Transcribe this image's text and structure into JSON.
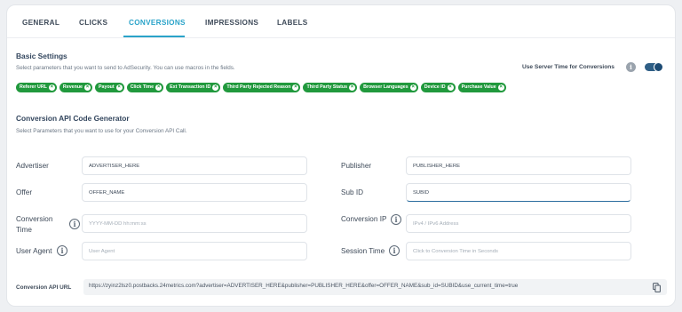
{
  "tabs": [
    {
      "label": "GENERAL"
    },
    {
      "label": "CLICKS"
    },
    {
      "label": "CONVERSIONS",
      "active": true
    },
    {
      "label": "IMPRESSIONS"
    },
    {
      "label": "LABELS"
    }
  ],
  "basic_settings": {
    "title": "Basic Settings",
    "hint": "Select parameters that you want to send to AdSecurity. You can use macros in the fields.",
    "server_time_label": "Use Server Time for Conversions",
    "server_time_enabled": true,
    "chips": [
      "Referer URL",
      "Revenue",
      "Payout",
      "Click Time",
      "Ext Transaction ID",
      "Third Party Rejected Reason",
      "Third Party Status",
      "Browser Languages",
      "Device ID",
      "Purchase Value"
    ]
  },
  "api_generator": {
    "title": "Conversion API Code Generator",
    "hint": "Select Parameters that you want to use for your Conversion API Call.",
    "fields": {
      "advertiser": {
        "label": "Advertiser",
        "value": "ADVERTISER_HERE",
        "placeholder": ""
      },
      "publisher": {
        "label": "Publisher",
        "value": "PUBLISHER_HERE",
        "placeholder": ""
      },
      "offer": {
        "label": "Offer",
        "value": "OFFER_NAME",
        "placeholder": ""
      },
      "sub_id": {
        "label": "Sub ID",
        "value": "SUBID",
        "placeholder": ""
      },
      "conversion_time": {
        "label_line1": "Conversion",
        "label_line2": "Time",
        "value": "",
        "placeholder": "YYYY-MM-DD hh:mm:ss"
      },
      "conversion_ip": {
        "label": "Conversion IP",
        "value": "",
        "placeholder": "IPv4 / IPv6 Address"
      },
      "user_agent": {
        "label": "User Agent",
        "value": "",
        "placeholder": "User Agent"
      },
      "session_time": {
        "label": "Session Time",
        "value": "",
        "placeholder": "Click to Conversion Time in Seconds"
      }
    },
    "url_label": "Conversion API URL",
    "url_value": "https://zyinz2lsz0.postbacks.24metrics.com?advertiser=ADVERTISER_HERE&publisher=PUBLISHER_HERE&offer=OFFER_NAME&sub_id=SUBID&use_current_time=true"
  },
  "icons": {
    "info": "info-icon",
    "chip_remove": "close-circle-icon",
    "copy": "copy-icon"
  },
  "colors": {
    "accent": "#2aa3c9",
    "chip": "#21993d",
    "toggle": "#1d4b74"
  }
}
